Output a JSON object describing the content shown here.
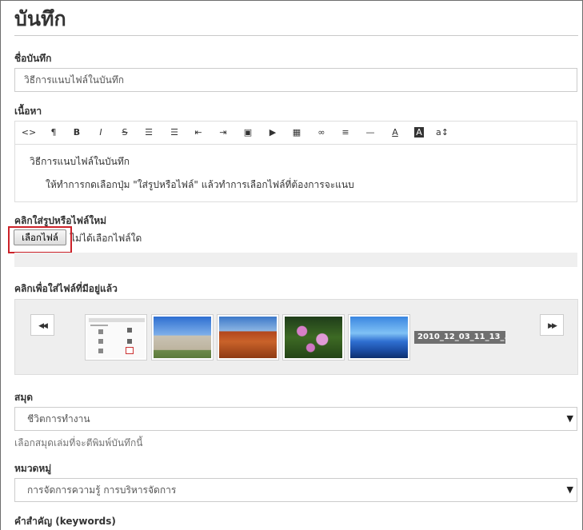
{
  "page": {
    "title": "บันทึก"
  },
  "note_title": {
    "label": "ชื่อบันทึก",
    "value": "วิธีการแนบไฟล์ในบันทึก"
  },
  "content": {
    "label": "เนื้อหา",
    "toolbar": [
      {
        "name": "code-view-icon",
        "glyph": "<>"
      },
      {
        "name": "paragraph-icon",
        "glyph": "¶"
      },
      {
        "name": "bold-icon",
        "glyph": "B"
      },
      {
        "name": "italic-icon",
        "glyph": "I"
      },
      {
        "name": "strikethrough-icon",
        "glyph": "S"
      },
      {
        "name": "unordered-list-icon",
        "glyph": "☰"
      },
      {
        "name": "ordered-list-icon",
        "glyph": "☰"
      },
      {
        "name": "outdent-icon",
        "glyph": "⇤"
      },
      {
        "name": "indent-icon",
        "glyph": "⇥"
      },
      {
        "name": "image-icon",
        "glyph": "▣"
      },
      {
        "name": "video-icon",
        "glyph": "▶"
      },
      {
        "name": "table-icon",
        "glyph": "▦"
      },
      {
        "name": "link-icon",
        "glyph": "∞"
      },
      {
        "name": "align-icon",
        "glyph": "≡"
      },
      {
        "name": "horizontal-rule-icon",
        "glyph": "—"
      },
      {
        "name": "font-color-icon",
        "glyph": "A"
      },
      {
        "name": "background-color-icon",
        "glyph": "A"
      },
      {
        "name": "font-size-icon",
        "glyph": "a↕"
      }
    ],
    "body_line1": "วิธีการแนบไฟล์ในบันทึก",
    "body_line2": "ให้ทำการกดเลือกปุ่ม \"ใส่รูปหรือไฟล์\" แล้วทำการเลือกไฟล์ที่ต้องการจะแนบ"
  },
  "upload": {
    "label": "คลิกใส่รูปหรือไฟล์ใหม่",
    "button": "เลือกไฟล์",
    "status": "ไม่ได้เลือกไฟล์ใด"
  },
  "existing_files": {
    "label": "คลิกเพื่อใส่ไฟล์ที่มีอยู่แล้ว",
    "prev_glyph": "◀◀",
    "next_glyph": "▶▶",
    "file_tag": "2010_12_03_11_13_...",
    "thumbnails": [
      "screenshot-thumbnail",
      "building-thumbnail",
      "desert-thumbnail",
      "water-lilies-thumbnail",
      "blue-hills-thumbnail"
    ]
  },
  "notebook": {
    "label": "สมุด",
    "selected": "ชีวิตการทำงาน",
    "help": "เลือกสมุดเล่มที่จะตีพิมพ์บันทึกนี้"
  },
  "category": {
    "label": "หมวดหมู่",
    "selected": "การจัดการความรู้ การบริหารจัดการ"
  },
  "keywords": {
    "label": "คำสำคัญ (keywords)"
  },
  "colors": {
    "highlight": "#cc2229",
    "tag_bg": "#6f6f6f"
  }
}
